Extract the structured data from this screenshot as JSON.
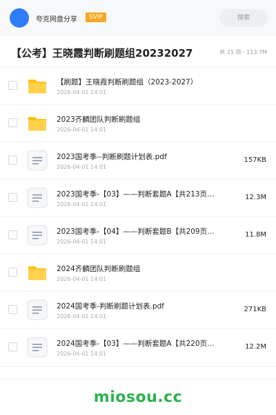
{
  "header": {
    "brand": "夸克网盘分享",
    "badge": "SVIP",
    "search_placeholder": "搜索"
  },
  "title": {
    "text": "【公考】王晓霞判断刷题组20232027",
    "summary": "共 21 项 · 113.7M"
  },
  "files": [
    {
      "type": "folder",
      "name": "【刷题】王晓霞判断刷题组（2023-2027）",
      "date": "2026-04-01 14:01",
      "size": ""
    },
    {
      "type": "folder",
      "name": "2023齐麟团队判断刷题组",
      "date": "2026-04-01 14:01",
      "size": ""
    },
    {
      "type": "file",
      "name": "2023国考季--判断刷题计划表.pdf",
      "date": "2026-04-01 14:01",
      "size": "157KB"
    },
    {
      "type": "file",
      "name": "2023国考季-【03】——判断套题A【共213页…",
      "date": "2026-04-01 14:01",
      "size": "12.3M"
    },
    {
      "type": "file",
      "name": "2023国考季-【04】——判断套题B【共209页…",
      "date": "2026-04-01 14:01",
      "size": "11.8M"
    },
    {
      "type": "folder",
      "name": "2024齐麟团队判断刷题组",
      "date": "2026-04-01 14:01",
      "size": ""
    },
    {
      "type": "file",
      "name": "2024国考季-判断刷题计划表.pdf",
      "date": "2026-04-01 14:01",
      "size": "271KB"
    },
    {
      "type": "file",
      "name": "2024国考季-【03】——判断套题A【共220页…",
      "date": "2026-04-01 14:01",
      "size": "12.2M"
    }
  ],
  "watermark": "miosou.cc",
  "colors": {
    "accent": "#2f7df6",
    "badge": "#f5a623",
    "folder": "#ffc21a",
    "watermark": "#2bb24c"
  }
}
